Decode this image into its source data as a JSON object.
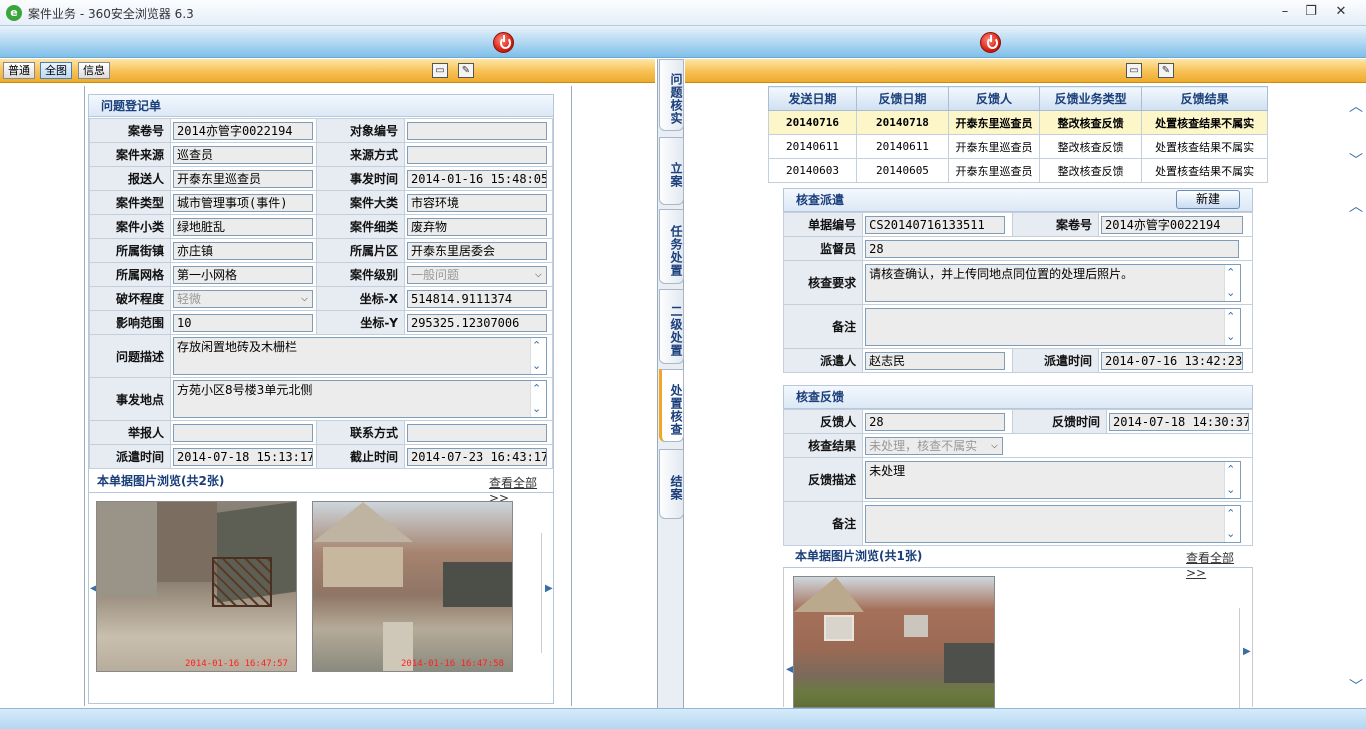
{
  "window": {
    "title": "案件业务 - 360安全浏览器 6.3",
    "logo": "e"
  },
  "left_toolbar": {
    "modes": [
      "普通",
      "全图",
      "信息"
    ]
  },
  "register": {
    "title": "问题登记单",
    "rows": [
      {
        "l1": "案卷号",
        "v1": "2014亦管字0022194",
        "l2": "对象编号",
        "v2": ""
      },
      {
        "l1": "案件来源",
        "v1": "巡查员",
        "l2": "来源方式",
        "v2": ""
      },
      {
        "l1": "报送人",
        "v1": "开泰东里巡查员",
        "l2": "事发时间",
        "v2": "2014-01-16 15:48:05"
      },
      {
        "l1": "案件类型",
        "v1": "城市管理事项(事件)",
        "l2": "案件大类",
        "v2": "市容环境"
      },
      {
        "l1": "案件小类",
        "v1": "绿地脏乱",
        "l2": "案件细类",
        "v2": "废弃物"
      },
      {
        "l1": "所属街镇",
        "v1": "亦庄镇",
        "l2": "所属片区",
        "v2": "开泰东里居委会"
      },
      {
        "l1": "所属网格",
        "v1": "第一小网格",
        "l2": "案件级别",
        "v2": "一般问题"
      },
      {
        "l1": "破坏程度",
        "v1": "轻微",
        "l2": "坐标-X",
        "v2": "514814.9111374"
      },
      {
        "l1": "影响范围",
        "v1": "10",
        "l2": "坐标-Y",
        "v2": "295325.12307006"
      }
    ],
    "desc_label": "问题描述",
    "desc": "存放闲置地砖及木栅栏",
    "place_label": "事发地点",
    "place": "方苑小区8号楼3单元北侧",
    "reporter_label": "举报人",
    "reporter": "",
    "contact_label": "联系方式",
    "contact": "",
    "dispatch_label": "派遣时间",
    "dispatch": "2014-07-18 15:13:17",
    "deadline_label": "截止时间",
    "deadline": "2014-07-23 16:43:17",
    "photos_title": "本单据图片浏览(共2张)",
    "more": "查看全部>>",
    "photo_ts": [
      "2014-01-16 16:47:57",
      "2014-01-16 16:47:58"
    ]
  },
  "vtabs": [
    "问题核实",
    "立案",
    "任务处置",
    "二级处置",
    "处置核查",
    "结案"
  ],
  "history": {
    "headers": [
      "发送日期",
      "反馈日期",
      "反馈人",
      "反馈业务类型",
      "反馈结果"
    ],
    "rows": [
      [
        "20140716",
        "20140718",
        "开泰东里巡查员",
        "整改核查反馈",
        "处置核查结果不属实"
      ],
      [
        "20140611",
        "20140611",
        "开泰东里巡查员",
        "整改核查反馈",
        "处置核查结果不属实"
      ],
      [
        "20140603",
        "20140605",
        "开泰东里巡查员",
        "整改核查反馈",
        "处置核查结果不属实"
      ]
    ]
  },
  "dispatch": {
    "title": "核查派遣",
    "new_btn": "新建",
    "doc_label": "单据编号",
    "doc": "CS20140716133511",
    "case_label": "案卷号",
    "case": "2014亦管字0022194",
    "supervisor_label": "监督员",
    "supervisor": "28",
    "req_label": "核查要求",
    "req": "请核查确认，并上传同地点同位置的处理后照片。",
    "note_label": "备注",
    "note": "",
    "sender_label": "派遣人",
    "sender": "赵志民",
    "time_label": "派遣时间",
    "time": "2014-07-16 13:42:23"
  },
  "feedback": {
    "title": "核查反馈",
    "person_label": "反馈人",
    "person": "28",
    "time_label": "反馈时间",
    "time": "2014-07-18 14:30:37",
    "result_label": "核查结果",
    "result": "未处理，核查不属实",
    "desc_label": "反馈描述",
    "desc": "未处理",
    "note_label": "备注",
    "note": "",
    "photos_title": "本单据图片浏览(共1张)",
    "more": "查看全部>>"
  }
}
